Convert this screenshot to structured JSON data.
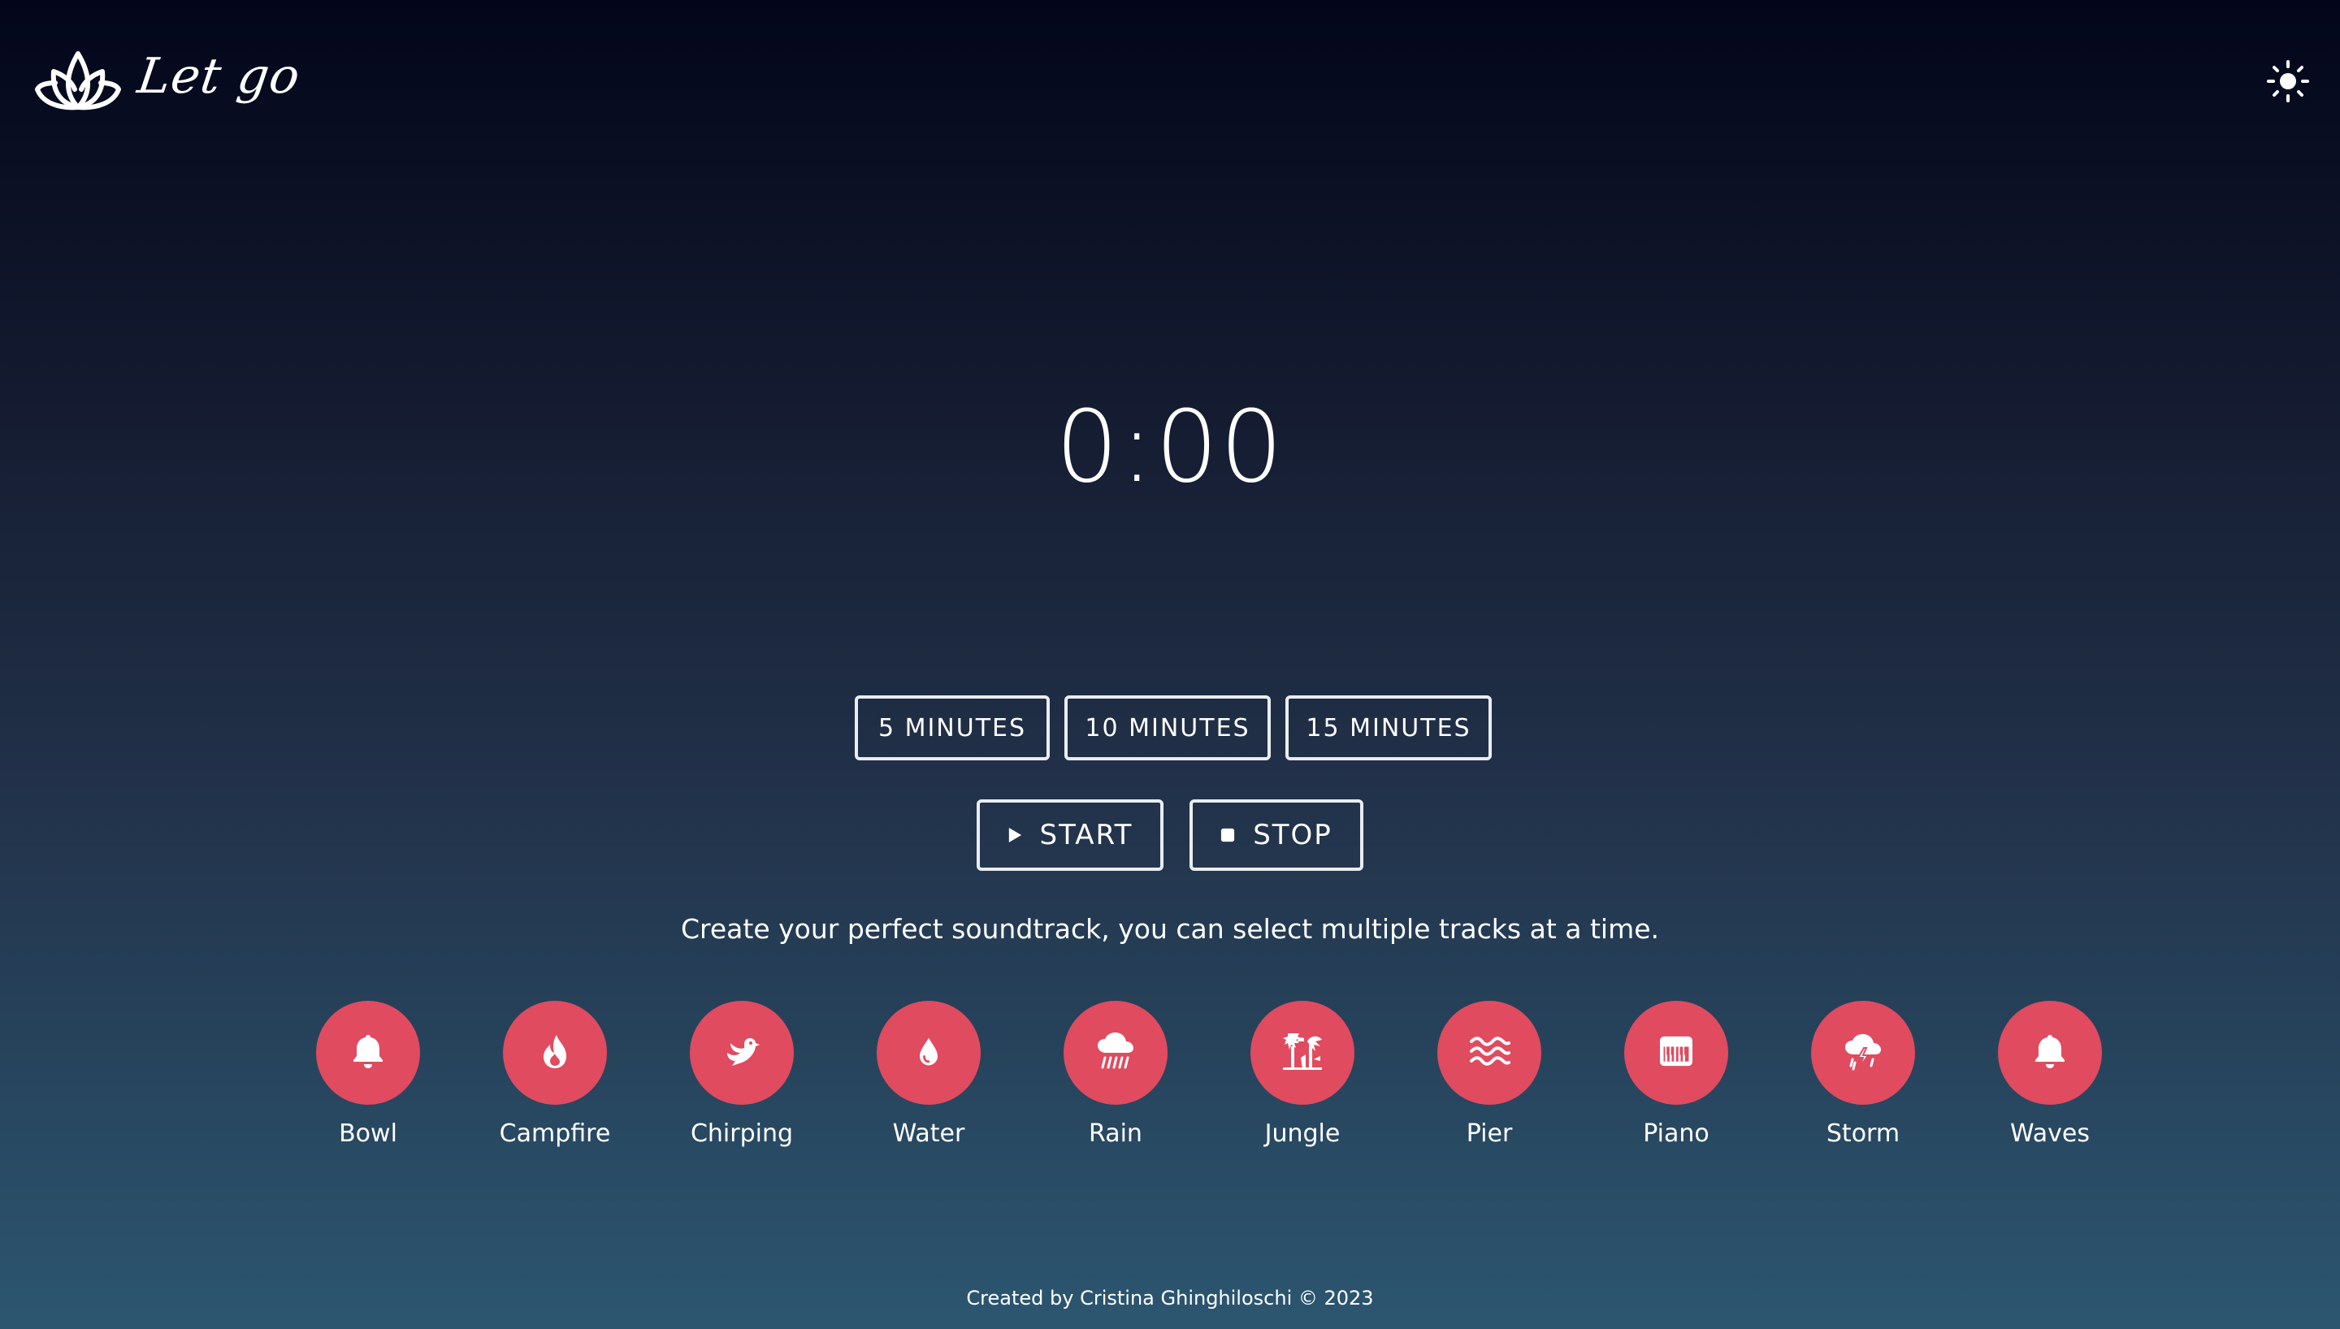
{
  "header": {
    "logo_text": "Let go",
    "logo_icon": "lotus-icon",
    "theme_toggle_icon": "sun-icon"
  },
  "timer": {
    "display": "0:00"
  },
  "durations": [
    {
      "label": "5 MINUTES"
    },
    {
      "label": "10 MINUTES"
    },
    {
      "label": "15 MINUTES"
    }
  ],
  "controls": {
    "start_label": "START",
    "start_icon": "play-icon",
    "stop_label": "STOP",
    "stop_icon": "stop-icon"
  },
  "hint": "Create your perfect soundtrack, you can select multiple tracks at a time.",
  "tracks": [
    {
      "label": "Bowl",
      "icon": "bell-icon"
    },
    {
      "label": "Campfire",
      "icon": "fire-icon"
    },
    {
      "label": "Chirping",
      "icon": "bird-icon"
    },
    {
      "label": "Water",
      "icon": "droplet-icon"
    },
    {
      "label": "Rain",
      "icon": "cloud-rain-icon"
    },
    {
      "label": "Jungle",
      "icon": "tree-icon"
    },
    {
      "label": "Pier",
      "icon": "waves-icon"
    },
    {
      "label": "Piano",
      "icon": "piano-icon"
    },
    {
      "label": "Storm",
      "icon": "cloud-bolt-icon"
    },
    {
      "label": "Waves",
      "icon": "bell-icon"
    }
  ],
  "colors": {
    "accent": "#e04b5f",
    "text": "#ffffff",
    "button_border": "#e9edf3"
  },
  "footer": {
    "text": "Created by Cristina Ghinghiloschi © 2023"
  }
}
